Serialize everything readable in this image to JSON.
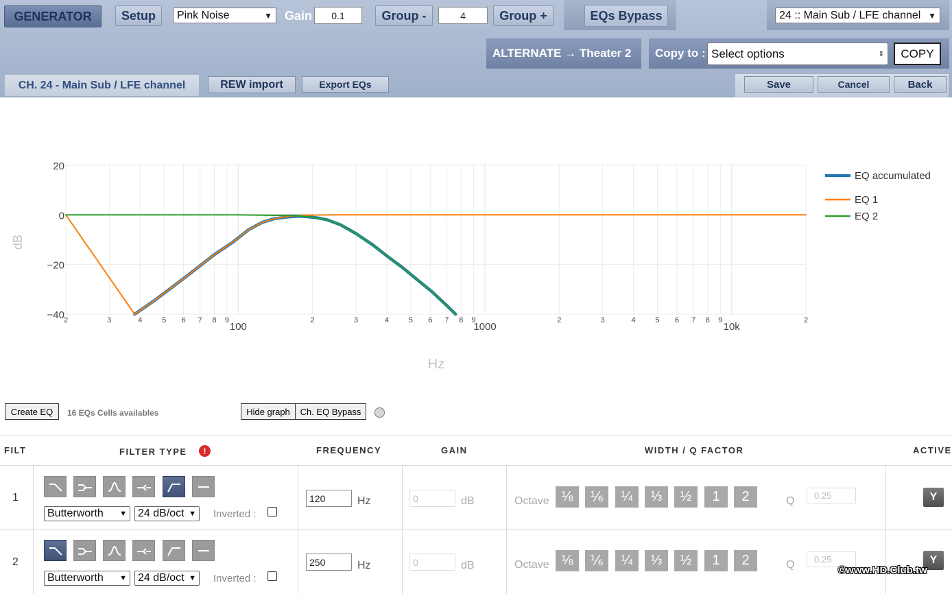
{
  "header": {
    "generator_label": "GENERATOR",
    "setup_label": "Setup",
    "signal_value": "Pink Noise",
    "gain_label": "Gain",
    "gain_value": "0.1",
    "group_minus_label": "Group -",
    "group_value": "4",
    "group_plus_label": "Group +",
    "eqs_bypass_label": "EQs Bypass",
    "channel_select_value": "24 :: Main Sub / LFE channel",
    "alternate_label": "ALTERNATE → Theater 2",
    "copy_to_label": "Copy to :",
    "copy_select_placeholder": "Select options",
    "copy_button_label": "COPY",
    "channel_title": "CH. 24 - Main Sub / LFE channel",
    "rew_import_label": "REW import",
    "export_eqs_label": "Export EQs",
    "save_label": "Save",
    "cancel_label": "Cancel",
    "back_label": "Back"
  },
  "chart_data": {
    "type": "line",
    "xlabel": "Hz",
    "ylabel": "dB",
    "x_scale": "log",
    "xlim": [
      20,
      20000
    ],
    "ylim": [
      -40,
      20
    ],
    "y_ticks": [
      "20",
      "0",
      "−20",
      "−40"
    ],
    "x_tick_labels": [
      "2",
      "3",
      "4",
      "5",
      "6",
      "7",
      "8",
      "9",
      "100",
      "2",
      "3",
      "4",
      "5",
      "6",
      "7",
      "8",
      "9",
      "1000",
      "2",
      "3",
      "4",
      "5",
      "6",
      "7",
      "8",
      "9",
      "10k",
      "2"
    ],
    "legend_position": "top-right",
    "series": [
      {
        "name": "EQ accumulated",
        "color": "#1f77b4",
        "x": [
          38,
          45,
          55,
          65,
          80,
          95,
          110,
          125,
          140,
          160,
          175,
          190,
          210,
          230,
          260,
          300,
          350,
          400,
          460,
          530,
          610,
          700,
          760
        ],
        "y": [
          -40,
          -35,
          -28.5,
          -23,
          -16,
          -11,
          -6,
          -3,
          -1.5,
          -0.8,
          -0.5,
          -0.7,
          -1.2,
          -2,
          -4,
          -7.5,
          -12,
          -16.5,
          -21,
          -26,
          -31,
          -36.5,
          -40
        ]
      },
      {
        "name": "EQ 1",
        "color": "#ff7f0e",
        "x": [
          20,
          38,
          45,
          55,
          65,
          80,
          95,
          110,
          125,
          140,
          160,
          180,
          200,
          250,
          20000
        ],
        "y": [
          0,
          -40,
          -35,
          -28.5,
          -23,
          -16,
          -11,
          -6,
          -3,
          -1.5,
          -0.6,
          -0.2,
          -0.05,
          0,
          0
        ]
      },
      {
        "name": "EQ 2",
        "color": "#2ca02c",
        "x": [
          20,
          100,
          150,
          175,
          190,
          210,
          230,
          260,
          300,
          350,
          400,
          460,
          530,
          610,
          700,
          760
        ],
        "y": [
          0,
          0,
          -0.2,
          -0.4,
          -0.7,
          -1.2,
          -2,
          -4,
          -7.5,
          -12,
          -16.5,
          -21,
          -26,
          -31,
          -36.5,
          -40
        ]
      }
    ]
  },
  "graph_controls": {
    "create_eq_label": "Create EQ",
    "cells_available": "16 EQs Cells availables",
    "hide_graph_label": "Hide graph",
    "ch_eq_bypass_label": "Ch. EQ Bypass"
  },
  "table": {
    "headers": {
      "filt": "FILT",
      "filter_type": "FILTER TYPE",
      "frequency": "FREQUENCY",
      "gain": "GAIN",
      "width_q": "WIDTH / Q FACTOR",
      "active": "ACTIVE"
    },
    "rows": [
      {
        "index": "1",
        "selected_shape": "highpass",
        "filter_family": "Butterworth",
        "slope": "24 dB/oct",
        "inverted_label": "Inverted :",
        "frequency": "120",
        "freq_unit": "Hz",
        "gain": "0",
        "gain_unit": "dB",
        "octave_label": "Octave",
        "q_label": "Q",
        "q_value": "0.25",
        "active": "Y"
      },
      {
        "index": "2",
        "selected_shape": "lowpass",
        "filter_family": "Butterworth",
        "slope": "24 dB/oct",
        "inverted_label": "Inverted :",
        "frequency": "250",
        "freq_unit": "Hz",
        "gain": "0",
        "gain_unit": "dB",
        "octave_label": "Octave",
        "q_label": "Q",
        "q_value": "0.25",
        "active": "Y"
      }
    ],
    "width_options": [
      "⅛",
      "⅙",
      "¼",
      "⅓",
      "½",
      "1",
      "2"
    ]
  },
  "watermark": "©www.HD.Club.tw"
}
